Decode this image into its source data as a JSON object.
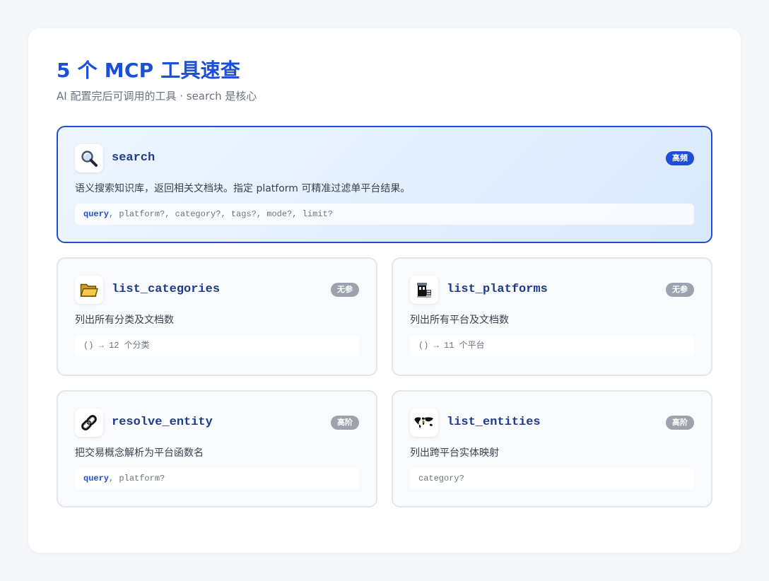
{
  "header": {
    "title": "5 个 MCP 工具速查",
    "subtitle": "AI 配置完后可调用的工具 · search 是核心"
  },
  "tools": [
    {
      "name": "search",
      "icon": "magnifier-icon",
      "badge": "高频",
      "description": "语义搜索知识库，返回相关文档块。指定 platform 可精准过滤单平台结果。",
      "signature_key": "query",
      "signature_rest": ", platform?, category?, tags?, mode?, limit?"
    },
    {
      "name": "list_categories",
      "icon": "folder-icon",
      "badge": "无参",
      "description": "列出所有分类及文档数",
      "signature_key": "",
      "signature_rest": "() → 12 个分类"
    },
    {
      "name": "list_platforms",
      "icon": "platform-icon",
      "badge": "无参",
      "description": "列出所有平台及文档数",
      "signature_key": "",
      "signature_rest": "() → 11 个平台"
    },
    {
      "name": "resolve_entity",
      "icon": "link-icon",
      "badge": "高阶",
      "description": "把交易概念解析为平台函数名",
      "signature_key": "query",
      "signature_rest": ", platform?"
    },
    {
      "name": "list_entities",
      "icon": "world-map-icon",
      "badge": "高阶",
      "description": "列出跨平台实体映射",
      "signature_key": "",
      "signature_rest": "category?"
    }
  ],
  "colors": {
    "accent": "#1d4ed8",
    "badge_muted": "#9ca3af",
    "tool_name": "#1e3a8a"
  }
}
